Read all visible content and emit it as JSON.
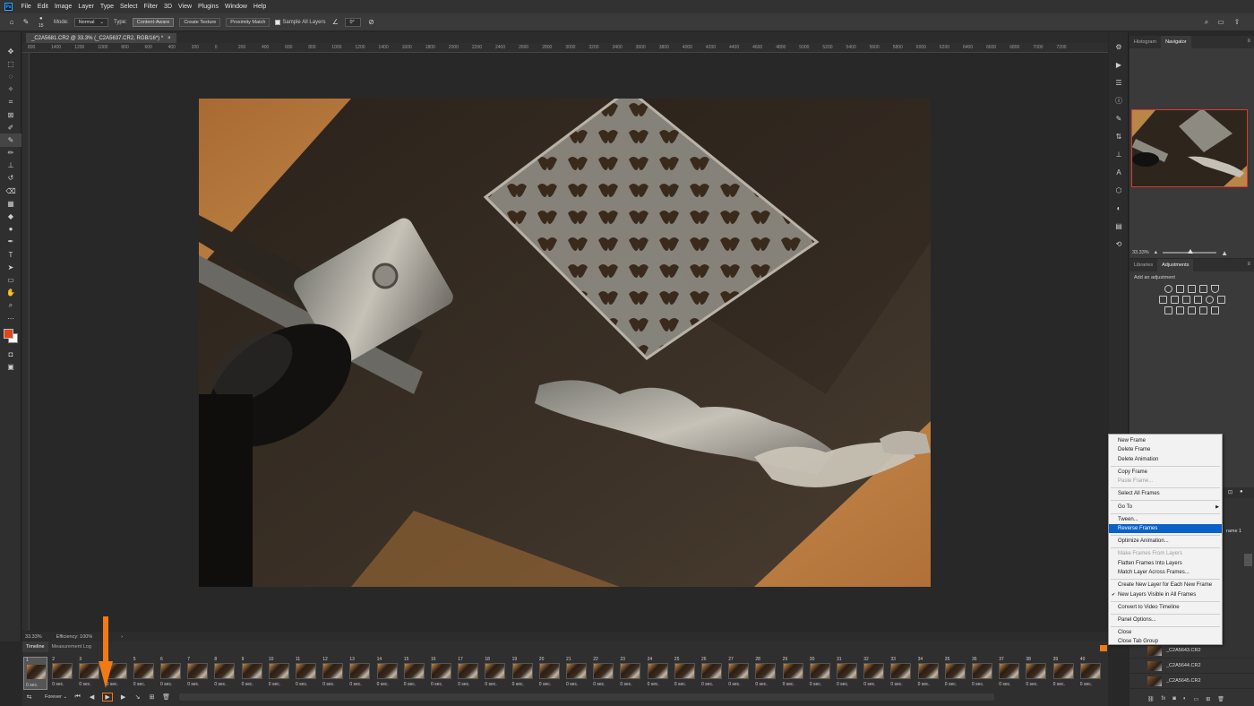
{
  "menubar": {
    "logo": "Ps",
    "items": [
      "File",
      "Edit",
      "Image",
      "Layer",
      "Type",
      "Select",
      "Filter",
      "3D",
      "View",
      "Plugins",
      "Window",
      "Help"
    ]
  },
  "options": {
    "brush_size": "15",
    "mode_label": "Mode:",
    "mode_value": "Normal",
    "type_label": "Type:",
    "type_buttons": [
      "Content-Aware",
      "Create Texture",
      "Proximity Match"
    ],
    "sample_all_layers": "Sample All Layers",
    "angle_value": "0°"
  },
  "document": {
    "tab_title": "_C2A5681.CR2 @ 33.3% (_C2A5637.CR2, RGB/16*) *",
    "close": "×",
    "zoom": "33.33%",
    "efficiency": "Efficiency: 100%",
    "ruler_marks": [
      "800",
      "1400",
      "1200",
      "1000",
      "800",
      "600",
      "400",
      "200",
      "0",
      "200",
      "400",
      "600",
      "800",
      "1000",
      "1200",
      "1400",
      "1600",
      "1800",
      "2000",
      "2200",
      "2400",
      "2600",
      "2800",
      "3000",
      "3200",
      "3400",
      "3600",
      "3800",
      "4000",
      "4200",
      "4400",
      "4600",
      "4800",
      "5000",
      "5200",
      "5400",
      "5600",
      "5800",
      "6000",
      "6200",
      "6400",
      "6600",
      "6800",
      "7000",
      "7200"
    ]
  },
  "right_panels": {
    "nav_tabs": [
      "Histogram",
      "Navigator"
    ],
    "nav_zoom": "33.33%",
    "adj_tabs": [
      "Libraries",
      "Adjustments"
    ],
    "adj_hint": "Add an adjustment",
    "layers": [
      "_C2A5643.CR2",
      "_C2A5644.CR2",
      "_C2A5645.CR2"
    ],
    "layer_partial": "rame 1"
  },
  "context_menu": {
    "items": [
      {
        "label": "New Frame"
      },
      {
        "label": "Delete Frame"
      },
      {
        "label": "Delete Animation"
      },
      {
        "sep": true
      },
      {
        "label": "Copy Frame"
      },
      {
        "label": "Paste Frame...",
        "disabled": true
      },
      {
        "sep": true
      },
      {
        "label": "Select All Frames"
      },
      {
        "sep": true
      },
      {
        "label": "Go To",
        "submenu": true
      },
      {
        "sep": true
      },
      {
        "label": "Tween..."
      },
      {
        "label": "Reverse Frames",
        "highlighted": true
      },
      {
        "sep": true
      },
      {
        "label": "Optimize Animation..."
      },
      {
        "sep": true
      },
      {
        "label": "Make Frames From Layers",
        "disabled": true
      },
      {
        "label": "Flatten Frames Into Layers"
      },
      {
        "label": "Match Layer Across Frames..."
      },
      {
        "sep": true
      },
      {
        "label": "Create New Layer for Each New Frame"
      },
      {
        "label": "New Layers Visible in All Frames",
        "checked": true
      },
      {
        "sep": true
      },
      {
        "label": "Convert to Video Timeline"
      },
      {
        "sep": true
      },
      {
        "label": "Panel Options..."
      },
      {
        "sep": true
      },
      {
        "label": "Close"
      },
      {
        "label": "Close Tab Group"
      }
    ]
  },
  "timeline": {
    "tabs": [
      "Timeline",
      "Measurement Log"
    ],
    "frame_count": 41,
    "frame_delay": "0 sec.",
    "loop": "Forever"
  },
  "colors": {
    "accent_orange": "#f07a14",
    "menu_highlight": "#0a62c8",
    "foreground_swatch": "#e0461b",
    "background_swatch": "#ffffff"
  }
}
